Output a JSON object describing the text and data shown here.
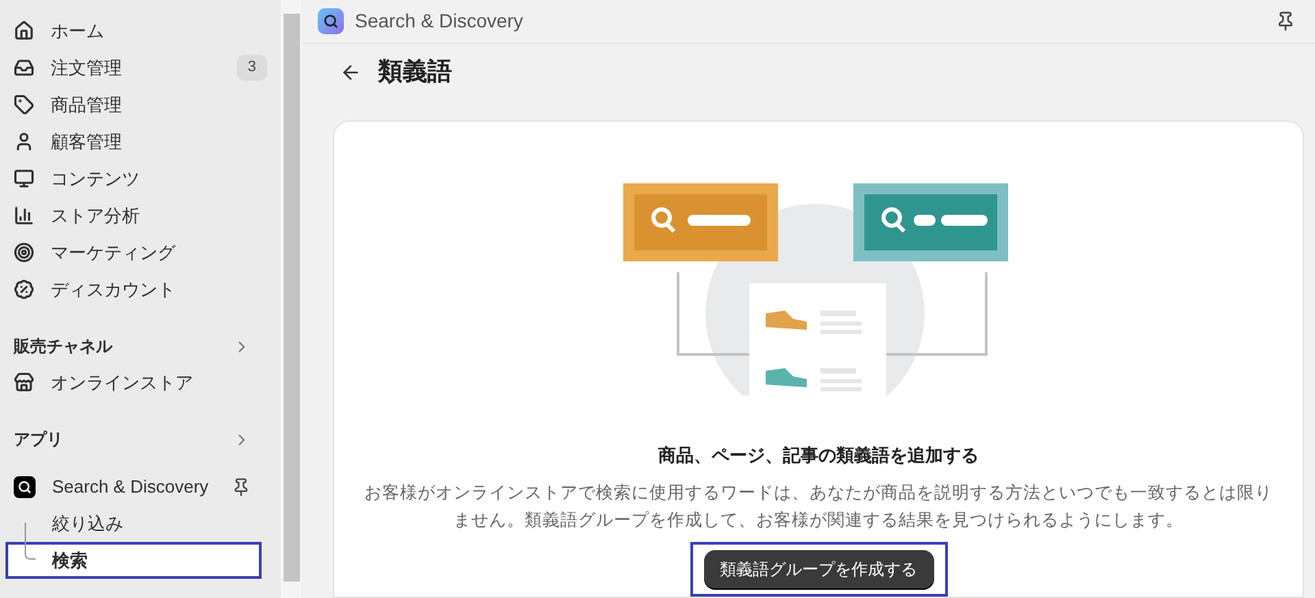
{
  "sidebar": {
    "items": [
      {
        "label": "ホーム",
        "kind": "home"
      },
      {
        "label": "注文管理",
        "kind": "orders",
        "badge": "3"
      },
      {
        "label": "商品管理",
        "kind": "products"
      },
      {
        "label": "顧客管理",
        "kind": "customers"
      },
      {
        "label": "コンテンツ",
        "kind": "content"
      },
      {
        "label": "ストア分析",
        "kind": "analytics"
      },
      {
        "label": "マーケティング",
        "kind": "marketing"
      },
      {
        "label": "ディスカウント",
        "kind": "discounts"
      }
    ],
    "sales_channels": {
      "title": "販売チャネル",
      "items": [
        {
          "label": "オンラインストア",
          "kind": "store"
        }
      ]
    },
    "apps": {
      "title": "アプリ",
      "app": {
        "label": "Search & Discovery",
        "children": [
          {
            "label": "絞り込み",
            "selected": false,
            "highlighted": false
          },
          {
            "label": "検索",
            "selected": true,
            "highlighted": true
          }
        ]
      }
    }
  },
  "app_header": {
    "title": "Search & Discovery"
  },
  "page": {
    "title": "類義語"
  },
  "empty_state": {
    "heading": "商品、ページ、記事の類義語を追加する",
    "body": "お客様がオンラインストアで検索に使用するワードは、あなたが商品を説明する方法といつでも一致するとは限りません。類義語グループを作成して、お客様が関連する結果を見つけられるようにします。",
    "button": {
      "label": "類義語グループを作成する",
      "highlighted": true
    }
  }
}
